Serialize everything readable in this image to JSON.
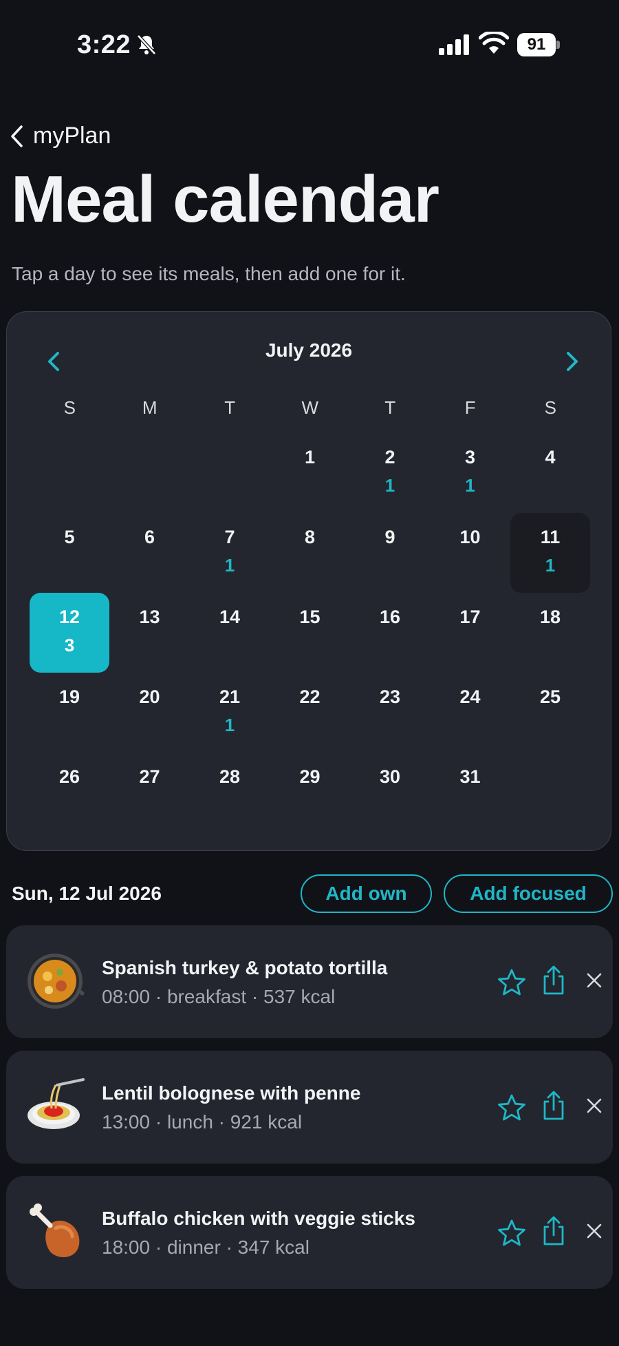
{
  "status": {
    "time": "3:22",
    "battery": "91"
  },
  "nav": {
    "back_label": "myPlan"
  },
  "page": {
    "title": "Meal calendar",
    "subtitle": "Tap a day to see its meals, then add one for it."
  },
  "calendar": {
    "month_label": "July 2026",
    "weekdays": [
      "S",
      "M",
      "T",
      "W",
      "T",
      "F",
      "S"
    ],
    "leading_blanks": 3,
    "days": [
      {
        "day": "1",
        "count": ""
      },
      {
        "day": "2",
        "count": "1"
      },
      {
        "day": "3",
        "count": "1"
      },
      {
        "day": "4",
        "count": ""
      },
      {
        "day": "5",
        "count": ""
      },
      {
        "day": "6",
        "count": ""
      },
      {
        "day": "7",
        "count": "1"
      },
      {
        "day": "8",
        "count": ""
      },
      {
        "day": "9",
        "count": ""
      },
      {
        "day": "10",
        "count": ""
      },
      {
        "day": "11",
        "count": "1",
        "today": true
      },
      {
        "day": "12",
        "count": "3",
        "selected": true
      },
      {
        "day": "13",
        "count": ""
      },
      {
        "day": "14",
        "count": ""
      },
      {
        "day": "15",
        "count": ""
      },
      {
        "day": "16",
        "count": ""
      },
      {
        "day": "17",
        "count": ""
      },
      {
        "day": "18",
        "count": ""
      },
      {
        "day": "19",
        "count": ""
      },
      {
        "day": "20",
        "count": ""
      },
      {
        "day": "21",
        "count": "1"
      },
      {
        "day": "22",
        "count": ""
      },
      {
        "day": "23",
        "count": ""
      },
      {
        "day": "24",
        "count": ""
      },
      {
        "day": "25",
        "count": ""
      },
      {
        "day": "26",
        "count": ""
      },
      {
        "day": "27",
        "count": ""
      },
      {
        "day": "28",
        "count": ""
      },
      {
        "day": "29",
        "count": ""
      },
      {
        "day": "30",
        "count": ""
      },
      {
        "day": "31",
        "count": ""
      }
    ]
  },
  "selection": {
    "date_label": "Sun, 12 Jul 2026",
    "add_own_label": "Add own",
    "add_focused_label": "Add focused"
  },
  "meals": [
    {
      "name": "Spanish turkey & potato tortilla",
      "meta": "08:00 · breakfast · 537 kcal",
      "icon": "paella-pan-icon"
    },
    {
      "name": "Lentil bolognese with penne",
      "meta": "13:00 · lunch · 921 kcal",
      "icon": "spaghetti-icon"
    },
    {
      "name": "Buffalo chicken with veggie sticks",
      "meta": "18:00 · dinner · 347 kcal",
      "icon": "chicken-leg-icon"
    }
  ],
  "colors": {
    "accent": "#16b8c8",
    "background": "#111217",
    "card": "#23262e"
  }
}
